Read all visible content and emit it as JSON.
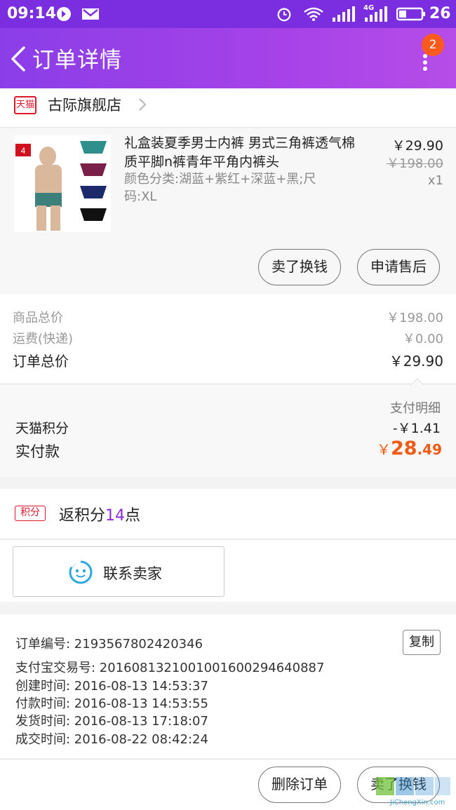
{
  "status_bar": {
    "time": "09:14",
    "battery": "26",
    "net": "4G"
  },
  "header": {
    "title": "订单详情",
    "badge": "2"
  },
  "shop": {
    "logo_text": "天猫",
    "name": "古际旗舰店"
  },
  "product": {
    "title": "礼盒装夏季男士内裤 男式三角裤透气棉质平脚n裤青年平角内裤头",
    "variant": "颜色分类:湖蓝+紫红+深蓝+黑;尺码:XL",
    "price": "￥29.90",
    "original_price": "￥198.00",
    "qty": "x1",
    "thumb_count": "4",
    "buttons": [
      "卖了换钱",
      "申请售后"
    ]
  },
  "summary": {
    "goods_label": "商品总价",
    "goods_value": "￥198.00",
    "shipping_label": "运费(快递)",
    "shipping_value": "￥0.00",
    "total_label": "订单总价",
    "total_value": "￥29.90"
  },
  "payment": {
    "detail_link": "支付明细",
    "points_label": "天猫积分",
    "points_value": "-￥1.41",
    "paid_label": "实付款",
    "paid_currency": "￥",
    "paid_int": "28",
    "paid_dec": ".49"
  },
  "points": {
    "tag": "积分",
    "text_prefix": "返积分",
    "number": "14",
    "text_suffix": "点"
  },
  "contact": {
    "label": "联系卖家"
  },
  "order_info": {
    "copy_label": "复制",
    "lines": [
      "订单编号: 2193567802420346",
      "支付宝交易号: 2016081321001001600294640887",
      "创建时间: 2016-08-13 14:53:37",
      "付款时间: 2016-08-13 14:53:55",
      "发货时间: 2016-08-13 17:18:07",
      "成交时间: 2016-08-22 08:42:24"
    ]
  },
  "bottom": {
    "delete_label": "删除订单",
    "sell_label": "卖了换钱"
  },
  "watermark": {
    "text": "JiChengXin.com"
  },
  "colors": {
    "header": "#8b3ee8",
    "badge": "#ff5a1e",
    "tmall_red": "#e0182c",
    "paid_orange": "#f05a12",
    "points_purple": "#8a2be2"
  }
}
